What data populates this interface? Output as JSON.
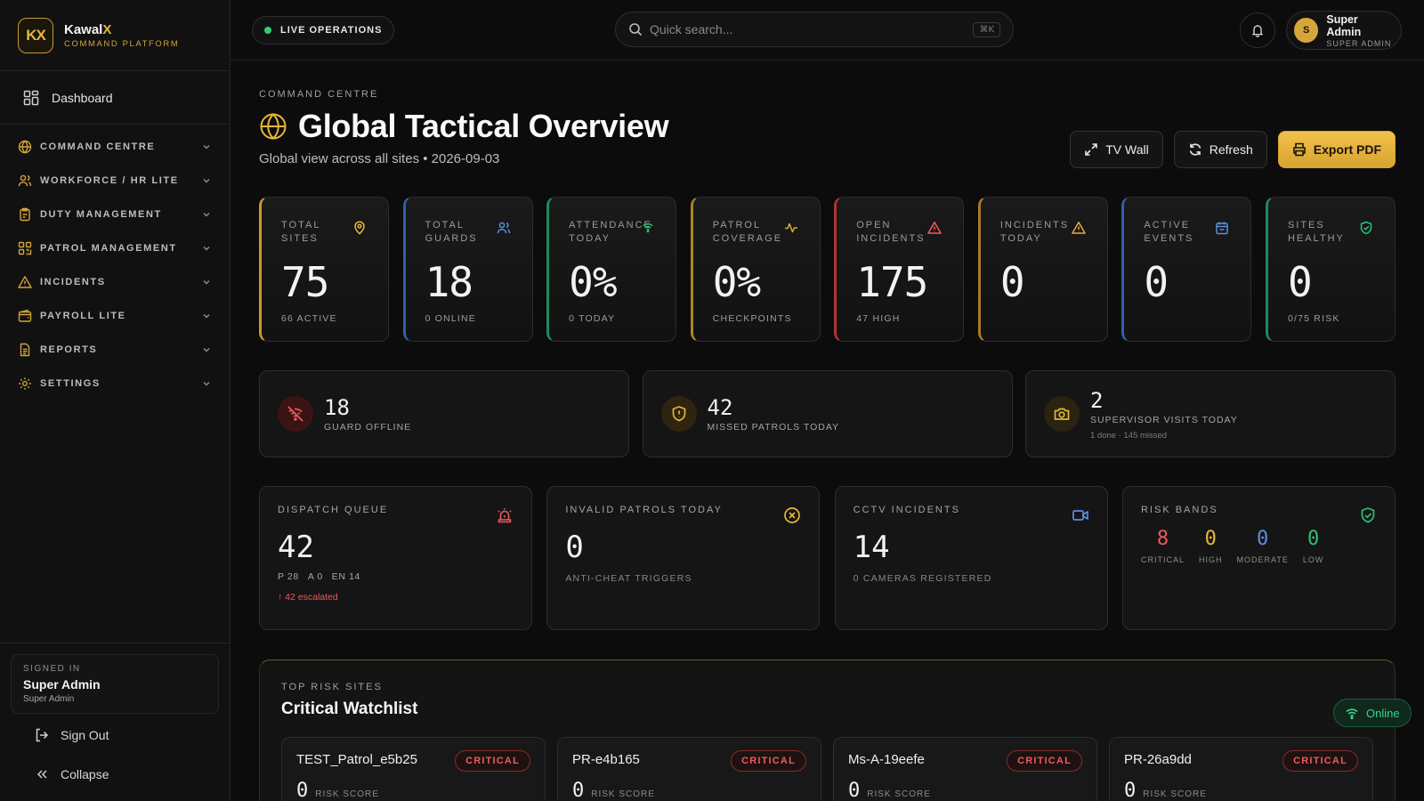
{
  "brand": {
    "logo": "KX",
    "name_main": "Kawal",
    "name_accent": "X",
    "tagline": "COMMAND PLATFORM"
  },
  "sidebar": {
    "dashboard": "Dashboard",
    "groups": [
      {
        "label": "COMMAND CENTRE",
        "icon": "globe-icon"
      },
      {
        "label": "WORKFORCE / HR LITE",
        "icon": "users-icon"
      },
      {
        "label": "DUTY MANAGEMENT",
        "icon": "clipboard-icon"
      },
      {
        "label": "PATROL MANAGEMENT",
        "icon": "grid-icon"
      },
      {
        "label": "INCIDENTS",
        "icon": "warning-icon"
      },
      {
        "label": "PAYROLL LITE",
        "icon": "wallet-icon"
      },
      {
        "label": "REPORTS",
        "icon": "document-icon"
      },
      {
        "label": "SETTINGS",
        "icon": "gear-icon"
      }
    ],
    "signed_in_label": "SIGNED IN",
    "signed_in_name": "Super Admin",
    "signed_in_role": "Super Admin",
    "sign_out": "Sign Out",
    "collapse": "Collapse"
  },
  "topbar": {
    "live_label": "LIVE OPERATIONS",
    "search_placeholder": "Quick search...",
    "search_shortcut": "⌘K",
    "user_initial": "S",
    "user_name": "Super Admin",
    "user_role": "SUPER ADMIN"
  },
  "page": {
    "eyebrow": "COMMAND CENTRE",
    "title": "Global Tactical Overview",
    "subtitle": "Global view across all sites • 2026-09-03",
    "actions": {
      "tv_wall": "TV Wall",
      "refresh": "Refresh",
      "export": "Export PDF"
    }
  },
  "stats": [
    {
      "label": "TOTAL SITES",
      "value": "75",
      "sub": "66 ACTIVE",
      "accent": "#c79a2e",
      "icon": "map-pin-icon",
      "icon_color": "#e7b73a"
    },
    {
      "label": "TOTAL GUARDS",
      "value": "18",
      "sub": "0 ONLINE",
      "accent": "#2f5fae",
      "icon": "users-icon",
      "icon_color": "#5b8fe3"
    },
    {
      "label": "ATTENDANCE TODAY",
      "value": "0%",
      "sub": "0 TODAY",
      "accent": "#1f8a5c",
      "icon": "wifi-icon",
      "icon_color": "#2fbf7a"
    },
    {
      "label": "PATROL COVERAGE",
      "value": "0%",
      "sub": "CHECKPOINTS",
      "accent": "#a88628",
      "icon": "activity-icon",
      "icon_color": "#d9ad3a"
    },
    {
      "label": "OPEN INCIDENTS",
      "value": "175",
      "sub": "47 HIGH",
      "accent": "#b23333",
      "icon": "warning-icon",
      "icon_color": "#ef5a5a"
    },
    {
      "label": "INCIDENTS TODAY",
      "value": "0",
      "sub": "",
      "accent": "#a8792a",
      "icon": "warning-icon",
      "icon_color": "#e7a93a"
    },
    {
      "label": "ACTIVE EVENTS",
      "value": "0",
      "sub": "",
      "accent": "#2f5fae",
      "icon": "calendar-icon",
      "icon_color": "#5b8fe3"
    },
    {
      "label": "SITES HEALTHY",
      "value": "0",
      "sub": "0/75 RISK",
      "accent": "#1f8a5c",
      "icon": "shield-check-icon",
      "icon_color": "#2fbf7a"
    }
  ],
  "alerts": [
    {
      "value": "18",
      "label": "GUARD OFFLINE",
      "extra": "",
      "icon": "wifi-off-icon",
      "icon_color": "#ef5a5a",
      "icon_bg": "#3a1414"
    },
    {
      "value": "42",
      "label": "MISSED PATROLS TODAY",
      "extra": "",
      "icon": "shield-alert-icon",
      "icon_color": "#e7b73a",
      "icon_bg": "#2e2410"
    },
    {
      "value": "2",
      "label": "SUPERVISOR VISITS TODAY",
      "extra": "1 done · 145 missed",
      "icon": "camera-icon",
      "icon_color": "#e7b73a",
      "icon_bg": "#2a2312"
    }
  ],
  "panels": {
    "dispatch": {
      "label": "DISPATCH QUEUE",
      "value": "42",
      "p": "P 28",
      "a": "A 0",
      "en": "EN 14",
      "escalated": "↑ 42 escalated",
      "icon": "siren-icon"
    },
    "invalid": {
      "label": "INVALID PATROLS TODAY",
      "value": "0",
      "sub": "ANTI-CHEAT TRIGGERS",
      "icon": "x-circle-icon"
    },
    "cctv": {
      "label": "CCTV INCIDENTS",
      "value": "14",
      "sub": "0 CAMERAS REGISTERED",
      "icon": "video-icon"
    },
    "risk": {
      "label": "RISK BANDS",
      "icon": "shield-check-icon",
      "bands": [
        {
          "value": "8",
          "label": "CRITICAL",
          "color": "#ef5a5a"
        },
        {
          "value": "0",
          "label": "HIGH",
          "color": "#e7b73a"
        },
        {
          "value": "0",
          "label": "MODERATE",
          "color": "#5b8fe3"
        },
        {
          "value": "0",
          "label": "LOW",
          "color": "#2fbf7a"
        }
      ]
    }
  },
  "watchlist": {
    "eyebrow": "TOP RISK SITES",
    "title": "Critical Watchlist",
    "sites": [
      {
        "name": "TEST_Patrol_e5b25",
        "badge": "CRITICAL",
        "score": "0",
        "score_label": "RISK SCORE"
      },
      {
        "name": "PR-e4b165",
        "badge": "CRITICAL",
        "score": "0",
        "score_label": "RISK SCORE"
      },
      {
        "name": "Ms-A-19eefe",
        "badge": "CRITICAL",
        "score": "0",
        "score_label": "RISK SCORE"
      },
      {
        "name": "PR-26a9dd",
        "badge": "CRITICAL",
        "score": "0",
        "score_label": "RISK SCORE"
      }
    ]
  },
  "status": {
    "online": "Online"
  }
}
